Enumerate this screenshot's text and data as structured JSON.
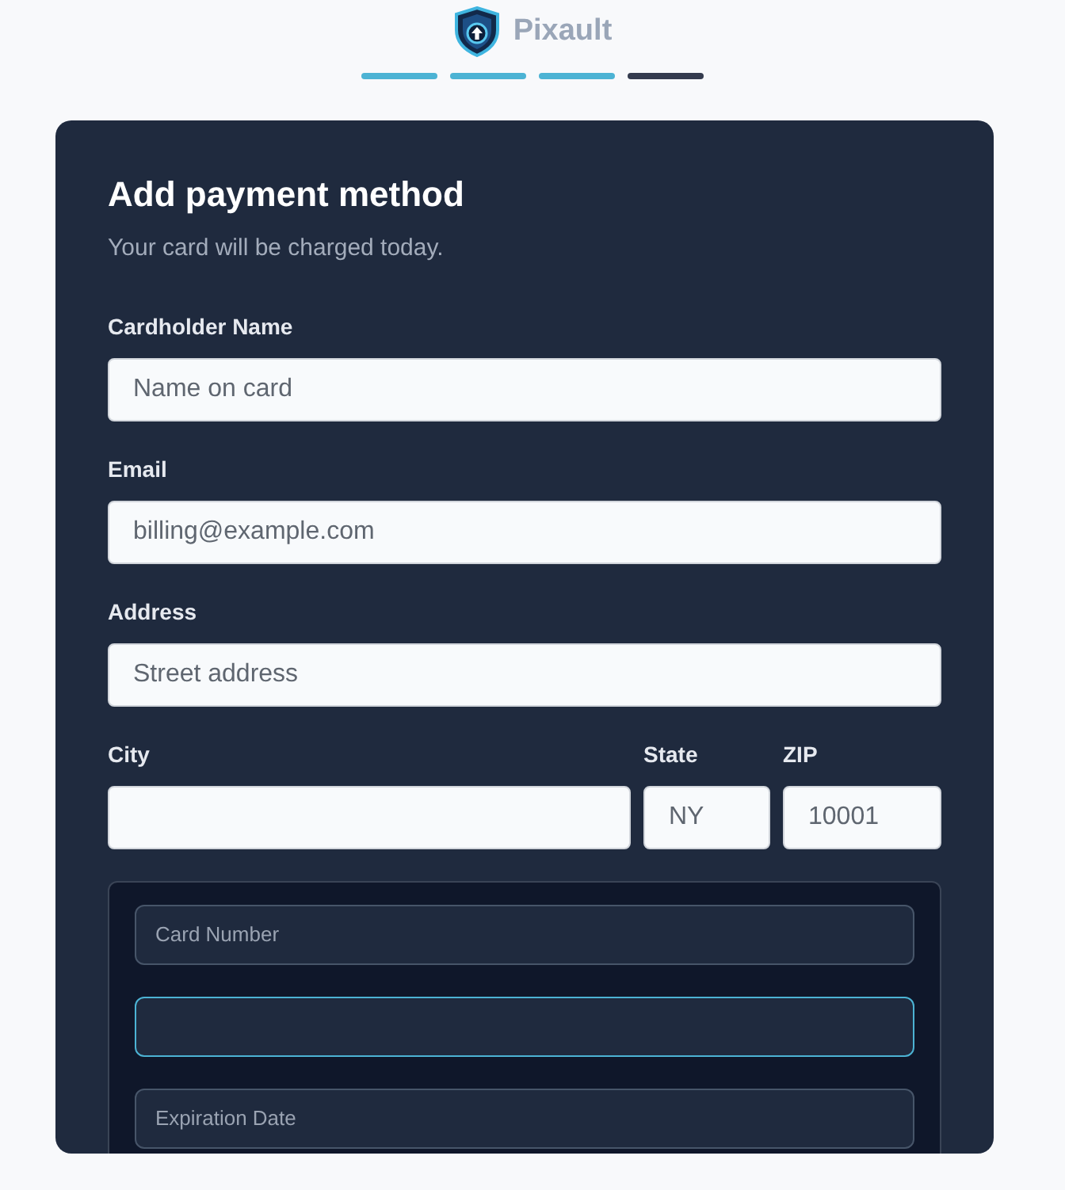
{
  "brand": {
    "name": "Pixault"
  },
  "steps": [
    {
      "done": true
    },
    {
      "done": true
    },
    {
      "done": true
    },
    {
      "done": false
    }
  ],
  "card": {
    "title": "Add payment method",
    "subtitle": "Your card will be charged today."
  },
  "fields": [
    {
      "label": "Cardholder Name",
      "placeholder": "Name on card"
    },
    {
      "label": "Email",
      "placeholder": "billing@example.com"
    },
    {
      "label": "Address",
      "placeholder": "Street address"
    }
  ],
  "location_fields": [
    {
      "label": "City"
    },
    {
      "label": "State",
      "placeholder": "NY"
    },
    {
      "label": "ZIP",
      "placeholder": "10001"
    }
  ],
  "payment_fields": [
    {
      "placeholder": "Card Number",
      "focused": false
    },
    {
      "focused": true
    },
    {
      "placeholder": "Expiration Date",
      "focused": false
    }
  ]
}
